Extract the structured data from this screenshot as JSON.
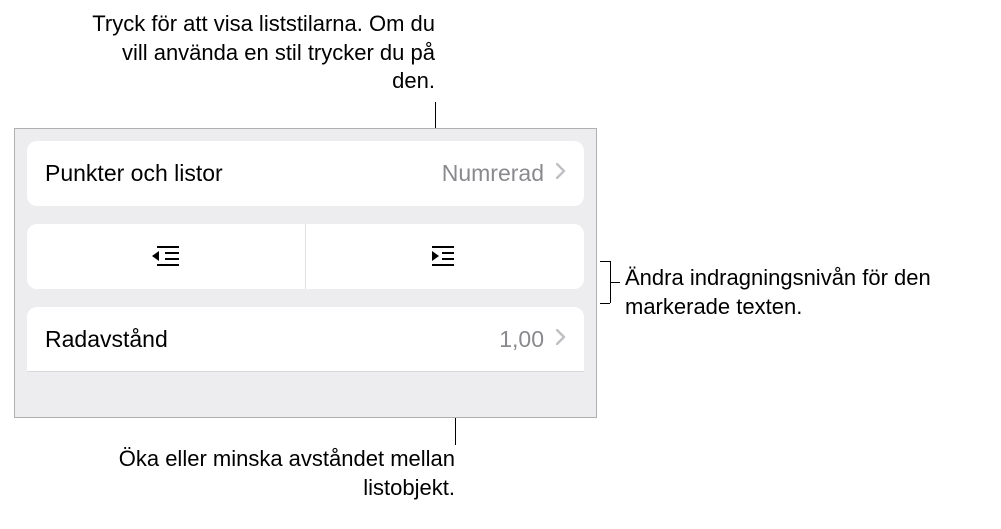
{
  "callouts": {
    "top": "Tryck för att visa liststilarna. Om du vill använda en stil trycker du på den.",
    "right": "Ändra indragningsnivån för den markerade texten.",
    "bottom": "Öka eller minska avståndet mellan listobjekt."
  },
  "panel": {
    "bullets_lists": {
      "label": "Punkter och listor",
      "value": "Numrerad"
    },
    "line_spacing": {
      "label": "Radavstånd",
      "value": "1,00"
    }
  }
}
